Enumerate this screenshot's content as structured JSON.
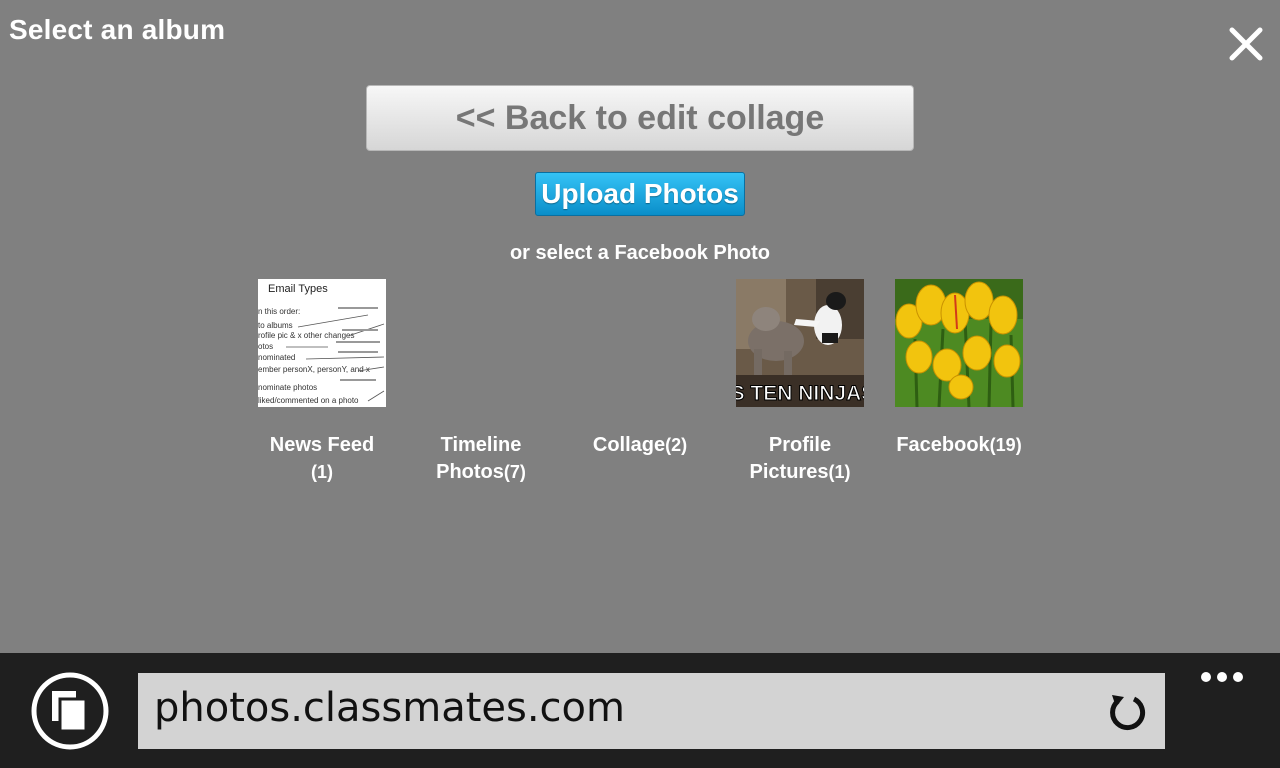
{
  "dialog": {
    "title": "Select an album",
    "close_icon": "close-icon",
    "back_label": "<< Back to edit collage",
    "upload_label": "Upload Photos",
    "subheading": "or select a Facebook Photo"
  },
  "albums": [
    {
      "name": "News Feed",
      "count": "(1)",
      "thumb": "email-types-document"
    },
    {
      "name": "Timeline Photos",
      "count": "(7)",
      "thumb": "none"
    },
    {
      "name": "Collage",
      "count": "(2)",
      "thumb": "none"
    },
    {
      "name": "Profile Pictures",
      "count": "(1)",
      "thumb": "dog-cat-meme"
    },
    {
      "name": "Facebook",
      "count": "(19)",
      "thumb": "yellow-tulips"
    }
  ],
  "thumb_text": {
    "email_types": "Email Types",
    "email_lines": [
      "n this order:",
      "to albums",
      "rofile pic & x other changes",
      "otos",
      "nominated",
      "ember personX, personY, and x",
      "nominate photos",
      "liked/commented on a photo"
    ],
    "meme_caption": "IS TEN NINJAS"
  },
  "browser": {
    "url": "photos.classmates.com",
    "tabs_icon": "tabs-icon",
    "refresh_icon": "refresh-icon",
    "more_icon": "more-dots-icon"
  },
  "colors": {
    "background": "#808080",
    "upload_blue": "#0a8ec9",
    "bar": "#1f1f1f",
    "address_bg": "#d3d3d3"
  }
}
